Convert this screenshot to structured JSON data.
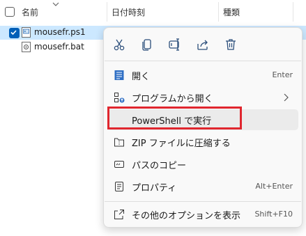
{
  "header": {
    "col_name": "名前",
    "col_date": "日付時刻",
    "col_type": "種類"
  },
  "files": [
    {
      "name": "mouse​fr.ps1",
      "selected": true
    },
    {
      "name": "mousefr.bat",
      "selected": false
    }
  ],
  "menu": {
    "quick_actions": [
      "cut-icon",
      "copy-icon",
      "rename-icon",
      "share-icon",
      "delete-icon"
    ],
    "items": [
      {
        "label": "開く",
        "shortcut": "Enter"
      },
      {
        "label": "プログラムから開く",
        "shortcut": ""
      },
      {
        "label": "PowerShell で実行",
        "shortcut": ""
      },
      {
        "label": "ZIP ファイルに圧縮する",
        "shortcut": ""
      },
      {
        "label": "パスのコピー",
        "shortcut": ""
      },
      {
        "label": "プロパティ",
        "shortcut": "Alt+Enter"
      },
      {
        "label": "その他のオプションを表示",
        "shortcut": "Shift+F10"
      }
    ]
  },
  "colors": {
    "accent": "#005fb8",
    "selection": "#cce8ff",
    "highlight_box": "#e0262e",
    "hover": "#ebebeb"
  }
}
